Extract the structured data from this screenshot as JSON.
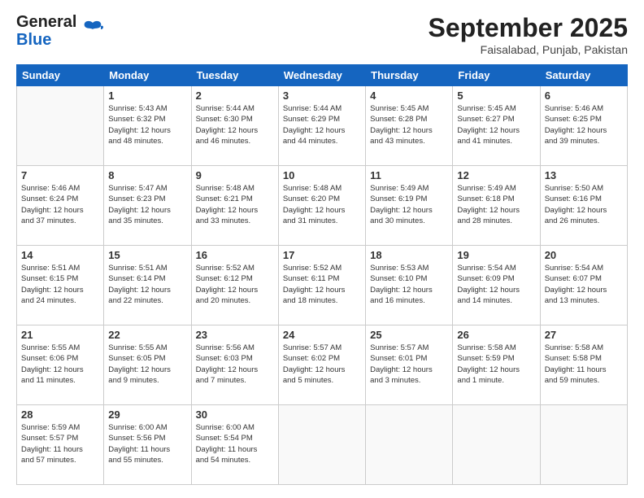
{
  "header": {
    "logo_general": "General",
    "logo_blue": "Blue",
    "month_title": "September 2025",
    "subtitle": "Faisalabad, Punjab, Pakistan"
  },
  "weekdays": [
    "Sunday",
    "Monday",
    "Tuesday",
    "Wednesday",
    "Thursday",
    "Friday",
    "Saturday"
  ],
  "weeks": [
    [
      {
        "day": "",
        "info": ""
      },
      {
        "day": "1",
        "info": "Sunrise: 5:43 AM\nSunset: 6:32 PM\nDaylight: 12 hours\nand 48 minutes."
      },
      {
        "day": "2",
        "info": "Sunrise: 5:44 AM\nSunset: 6:30 PM\nDaylight: 12 hours\nand 46 minutes."
      },
      {
        "day": "3",
        "info": "Sunrise: 5:44 AM\nSunset: 6:29 PM\nDaylight: 12 hours\nand 44 minutes."
      },
      {
        "day": "4",
        "info": "Sunrise: 5:45 AM\nSunset: 6:28 PM\nDaylight: 12 hours\nand 43 minutes."
      },
      {
        "day": "5",
        "info": "Sunrise: 5:45 AM\nSunset: 6:27 PM\nDaylight: 12 hours\nand 41 minutes."
      },
      {
        "day": "6",
        "info": "Sunrise: 5:46 AM\nSunset: 6:25 PM\nDaylight: 12 hours\nand 39 minutes."
      }
    ],
    [
      {
        "day": "7",
        "info": "Sunrise: 5:46 AM\nSunset: 6:24 PM\nDaylight: 12 hours\nand 37 minutes."
      },
      {
        "day": "8",
        "info": "Sunrise: 5:47 AM\nSunset: 6:23 PM\nDaylight: 12 hours\nand 35 minutes."
      },
      {
        "day": "9",
        "info": "Sunrise: 5:48 AM\nSunset: 6:21 PM\nDaylight: 12 hours\nand 33 minutes."
      },
      {
        "day": "10",
        "info": "Sunrise: 5:48 AM\nSunset: 6:20 PM\nDaylight: 12 hours\nand 31 minutes."
      },
      {
        "day": "11",
        "info": "Sunrise: 5:49 AM\nSunset: 6:19 PM\nDaylight: 12 hours\nand 30 minutes."
      },
      {
        "day": "12",
        "info": "Sunrise: 5:49 AM\nSunset: 6:18 PM\nDaylight: 12 hours\nand 28 minutes."
      },
      {
        "day": "13",
        "info": "Sunrise: 5:50 AM\nSunset: 6:16 PM\nDaylight: 12 hours\nand 26 minutes."
      }
    ],
    [
      {
        "day": "14",
        "info": "Sunrise: 5:51 AM\nSunset: 6:15 PM\nDaylight: 12 hours\nand 24 minutes."
      },
      {
        "day": "15",
        "info": "Sunrise: 5:51 AM\nSunset: 6:14 PM\nDaylight: 12 hours\nand 22 minutes."
      },
      {
        "day": "16",
        "info": "Sunrise: 5:52 AM\nSunset: 6:12 PM\nDaylight: 12 hours\nand 20 minutes."
      },
      {
        "day": "17",
        "info": "Sunrise: 5:52 AM\nSunset: 6:11 PM\nDaylight: 12 hours\nand 18 minutes."
      },
      {
        "day": "18",
        "info": "Sunrise: 5:53 AM\nSunset: 6:10 PM\nDaylight: 12 hours\nand 16 minutes."
      },
      {
        "day": "19",
        "info": "Sunrise: 5:54 AM\nSunset: 6:09 PM\nDaylight: 12 hours\nand 14 minutes."
      },
      {
        "day": "20",
        "info": "Sunrise: 5:54 AM\nSunset: 6:07 PM\nDaylight: 12 hours\nand 13 minutes."
      }
    ],
    [
      {
        "day": "21",
        "info": "Sunrise: 5:55 AM\nSunset: 6:06 PM\nDaylight: 12 hours\nand 11 minutes."
      },
      {
        "day": "22",
        "info": "Sunrise: 5:55 AM\nSunset: 6:05 PM\nDaylight: 12 hours\nand 9 minutes."
      },
      {
        "day": "23",
        "info": "Sunrise: 5:56 AM\nSunset: 6:03 PM\nDaylight: 12 hours\nand 7 minutes."
      },
      {
        "day": "24",
        "info": "Sunrise: 5:57 AM\nSunset: 6:02 PM\nDaylight: 12 hours\nand 5 minutes."
      },
      {
        "day": "25",
        "info": "Sunrise: 5:57 AM\nSunset: 6:01 PM\nDaylight: 12 hours\nand 3 minutes."
      },
      {
        "day": "26",
        "info": "Sunrise: 5:58 AM\nSunset: 5:59 PM\nDaylight: 12 hours\nand 1 minute."
      },
      {
        "day": "27",
        "info": "Sunrise: 5:58 AM\nSunset: 5:58 PM\nDaylight: 11 hours\nand 59 minutes."
      }
    ],
    [
      {
        "day": "28",
        "info": "Sunrise: 5:59 AM\nSunset: 5:57 PM\nDaylight: 11 hours\nand 57 minutes."
      },
      {
        "day": "29",
        "info": "Sunrise: 6:00 AM\nSunset: 5:56 PM\nDaylight: 11 hours\nand 55 minutes."
      },
      {
        "day": "30",
        "info": "Sunrise: 6:00 AM\nSunset: 5:54 PM\nDaylight: 11 hours\nand 54 minutes."
      },
      {
        "day": "",
        "info": ""
      },
      {
        "day": "",
        "info": ""
      },
      {
        "day": "",
        "info": ""
      },
      {
        "day": "",
        "info": ""
      }
    ]
  ]
}
